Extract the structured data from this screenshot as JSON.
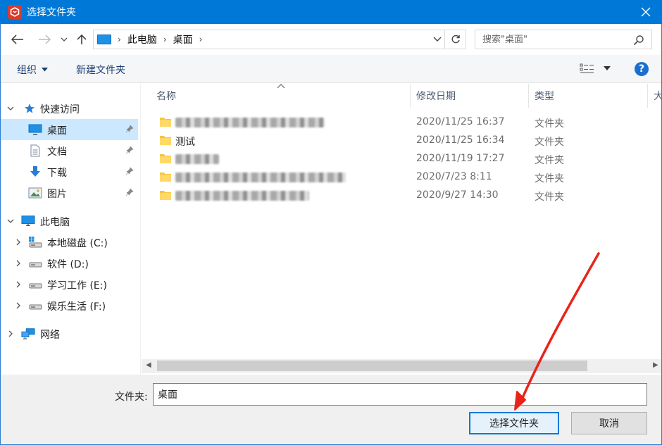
{
  "window": {
    "title": "选择文件夹",
    "app_icon": "app-logo-icon",
    "close_icon": "close-icon"
  },
  "address": {
    "crumbs": [
      "此电脑",
      "桌面"
    ],
    "search_placeholder": "搜索\"桌面\""
  },
  "toolbar": {
    "organize": "组织",
    "new_folder": "新建文件夹",
    "help": "?"
  },
  "nav": {
    "quick_access": "快速访问",
    "items": [
      {
        "label": "桌面",
        "icon": "desktop-icon"
      },
      {
        "label": "文档",
        "icon": "document-icon"
      },
      {
        "label": "下载",
        "icon": "download-icon"
      },
      {
        "label": "图片",
        "icon": "pictures-icon"
      }
    ],
    "this_pc": "此电脑",
    "drives": [
      "本地磁盘 (C:)",
      "软件 (D:)",
      "学习工作 (E:)",
      "娱乐生活 (F:)"
    ],
    "network": "网络"
  },
  "files": {
    "columns": [
      "名称",
      "修改日期",
      "类型",
      "大"
    ],
    "rows": [
      {
        "name": "",
        "date": "2020/11/25 16:37",
        "type": "文件夹"
      },
      {
        "name": "测试",
        "date": "2020/11/25 16:34",
        "type": "文件夹"
      },
      {
        "name": "",
        "date": "2020/11/19 17:27",
        "type": "文件夹"
      },
      {
        "name": "",
        "date": "2020/7/23 8:11",
        "type": "文件夹"
      },
      {
        "name": "",
        "date": "2020/9/27 14:30",
        "type": "文件夹"
      }
    ]
  },
  "footer": {
    "folder_label": "文件夹:",
    "folder_value": "桌面",
    "select_button": "选择文件夹",
    "cancel_button": "取消"
  },
  "colors": {
    "accent": "#0078d7",
    "annotation": "#e8241a",
    "selection": "#cce8ff"
  }
}
